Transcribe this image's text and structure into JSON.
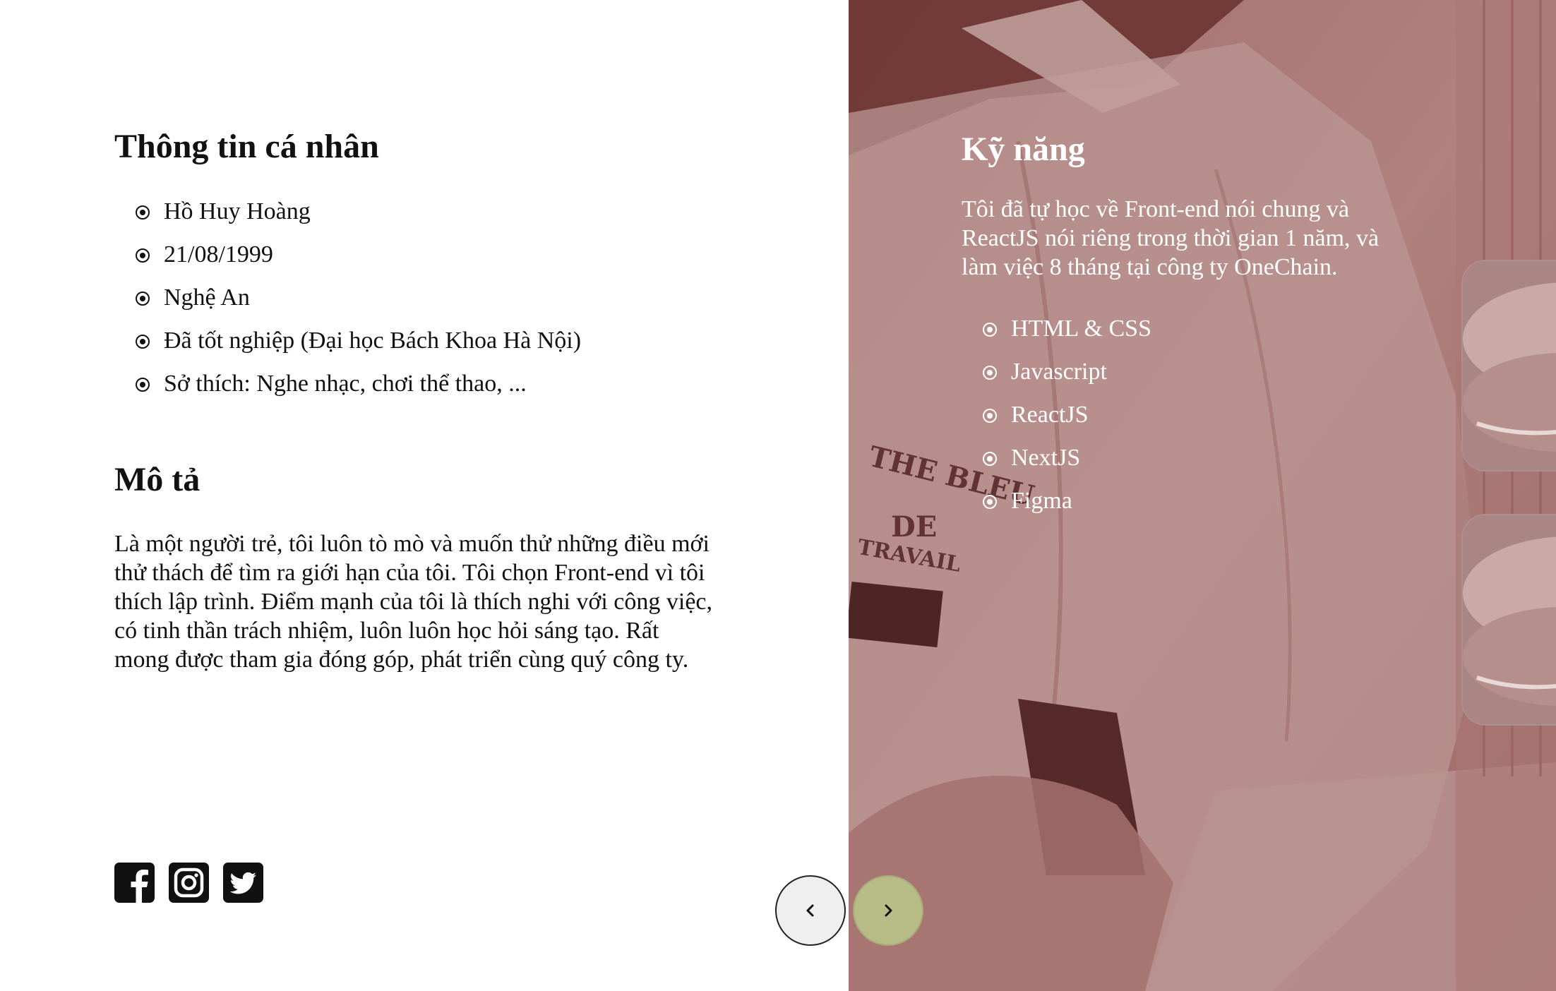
{
  "personal_info": {
    "title": "Thông tin cá nhân",
    "items": [
      {
        "text": "Hồ Huy Hoàng"
      },
      {
        "text": "21/08/1999"
      },
      {
        "text": "Nghệ An"
      },
      {
        "text": "Đã tốt nghiệp (Đại học Bách Khoa Hà Nội)"
      },
      {
        "text": "Sở thích: Nghe nhạc, chơi thể thao, ..."
      }
    ]
  },
  "description": {
    "title": "Mô tả",
    "text": "Là một người trẻ, tôi luôn tò mò và muốn thử những điều mới thử thách để tìm ra giới hạn của tôi. Tôi chọn Front-end vì tôi thích lập trình. Điểm mạnh của tôi là thích nghi với công việc, có tinh thần trách nhiệm, luôn luôn học hỏi sáng tạo. Rất mong được tham gia đóng góp, phát triển cùng quý công ty."
  },
  "social_icons": [
    "facebook-icon",
    "instagram-icon",
    "twitter-icon"
  ],
  "skills": {
    "title": "Kỹ năng",
    "intro": "Tôi đã tự học về Front-end nói chung và ReactJS nói riêng trong thời gian 1 năm, và làm việc 8 tháng tại công ty OneChain.",
    "items": [
      {
        "text": "HTML & CSS"
      },
      {
        "text": "Javascript"
      },
      {
        "text": "ReactJS"
      },
      {
        "text": "NextJS"
      },
      {
        "text": "Figma"
      }
    ]
  },
  "navigation": {
    "prev_icon": "chevron-left-icon",
    "next_icon": "chevron-right-icon"
  },
  "colors": {
    "overlay": "#6e2828",
    "next_button": "#b7bb85",
    "prev_button": "#efefef"
  }
}
